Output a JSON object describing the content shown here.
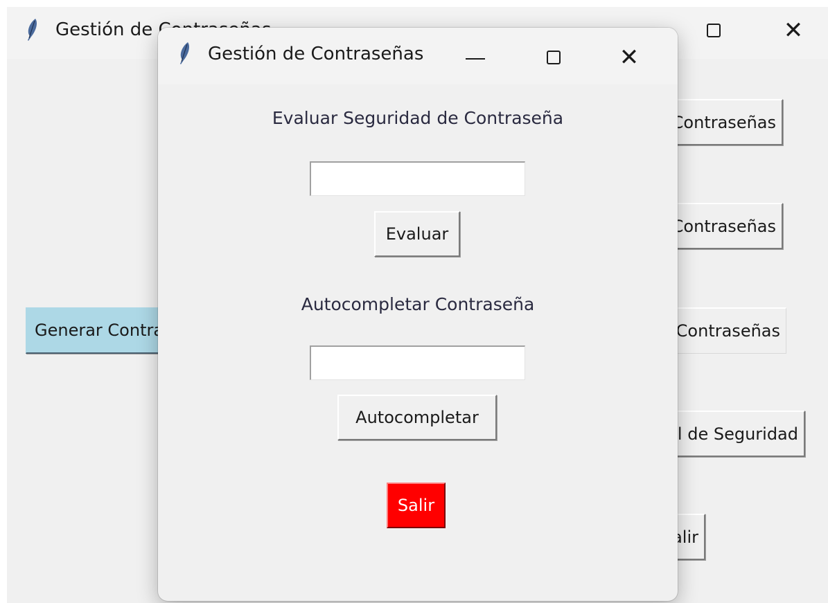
{
  "main_window": {
    "title": "Gestión de Contraseñas",
    "buttons": [
      {
        "label": "Generar Contraseña"
      },
      {
        "label": "Almacenar Contraseñas"
      },
      {
        "label": "Mostrar Contraseñas"
      },
      {
        "label": "Evaluar Contraseñas"
      },
      {
        "label": "Verificar Nivel de Seguridad"
      },
      {
        "label": "Salir"
      }
    ],
    "highlight_color": "#add8e6"
  },
  "dialog": {
    "title": "Gestión de Contraseñas",
    "evaluate_heading": "Evaluar Seguridad de Contraseña",
    "evaluate_input_value": "",
    "evaluate_button": "Evaluar",
    "autocomplete_heading": "Autocompletar Contraseña",
    "autocomplete_input_value": "",
    "autocomplete_button": "Autocompletar",
    "exit_button": "Salir",
    "exit_button_color": "#ff0000"
  },
  "icons": {
    "app_icon": "feather-icon",
    "minimize": "minimize-icon",
    "maximize": "maximize-icon",
    "close": "close-icon"
  }
}
